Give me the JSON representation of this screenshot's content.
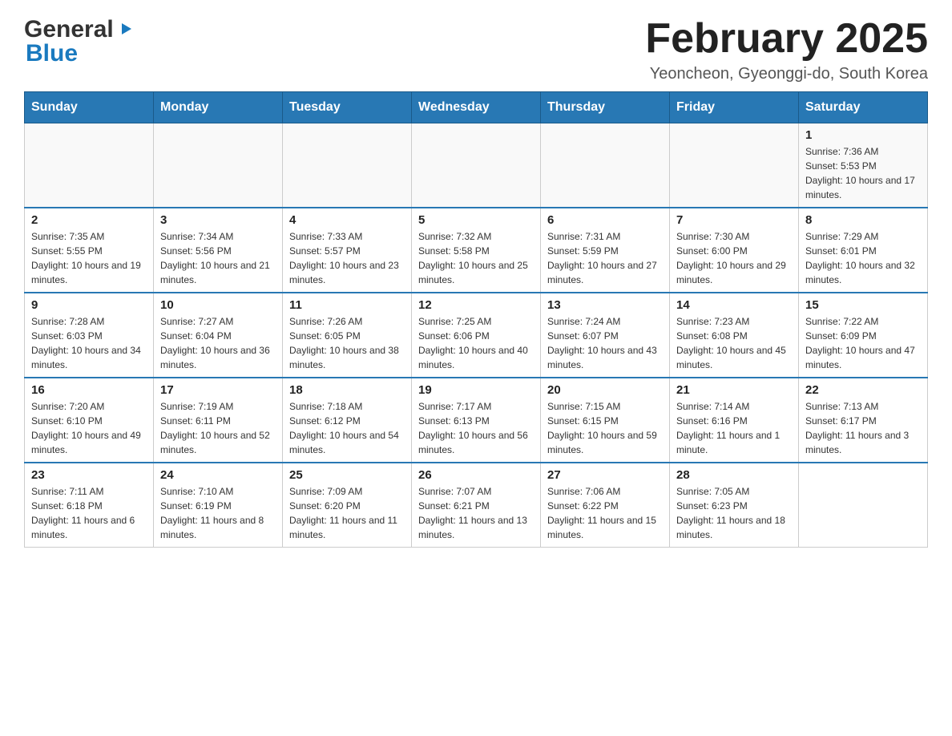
{
  "header": {
    "logo": {
      "general": "General",
      "blue": "Blue"
    },
    "title": "February 2025",
    "location": "Yeoncheon, Gyeonggi-do, South Korea"
  },
  "days_of_week": [
    "Sunday",
    "Monday",
    "Tuesday",
    "Wednesday",
    "Thursday",
    "Friday",
    "Saturday"
  ],
  "weeks": [
    {
      "days": [
        {
          "date": "",
          "sunrise": "",
          "sunset": "",
          "daylight": ""
        },
        {
          "date": "",
          "sunrise": "",
          "sunset": "",
          "daylight": ""
        },
        {
          "date": "",
          "sunrise": "",
          "sunset": "",
          "daylight": ""
        },
        {
          "date": "",
          "sunrise": "",
          "sunset": "",
          "daylight": ""
        },
        {
          "date": "",
          "sunrise": "",
          "sunset": "",
          "daylight": ""
        },
        {
          "date": "",
          "sunrise": "",
          "sunset": "",
          "daylight": ""
        },
        {
          "date": "1",
          "sunrise": "Sunrise: 7:36 AM",
          "sunset": "Sunset: 5:53 PM",
          "daylight": "Daylight: 10 hours and 17 minutes."
        }
      ]
    },
    {
      "days": [
        {
          "date": "2",
          "sunrise": "Sunrise: 7:35 AM",
          "sunset": "Sunset: 5:55 PM",
          "daylight": "Daylight: 10 hours and 19 minutes."
        },
        {
          "date": "3",
          "sunrise": "Sunrise: 7:34 AM",
          "sunset": "Sunset: 5:56 PM",
          "daylight": "Daylight: 10 hours and 21 minutes."
        },
        {
          "date": "4",
          "sunrise": "Sunrise: 7:33 AM",
          "sunset": "Sunset: 5:57 PM",
          "daylight": "Daylight: 10 hours and 23 minutes."
        },
        {
          "date": "5",
          "sunrise": "Sunrise: 7:32 AM",
          "sunset": "Sunset: 5:58 PM",
          "daylight": "Daylight: 10 hours and 25 minutes."
        },
        {
          "date": "6",
          "sunrise": "Sunrise: 7:31 AM",
          "sunset": "Sunset: 5:59 PM",
          "daylight": "Daylight: 10 hours and 27 minutes."
        },
        {
          "date": "7",
          "sunrise": "Sunrise: 7:30 AM",
          "sunset": "Sunset: 6:00 PM",
          "daylight": "Daylight: 10 hours and 29 minutes."
        },
        {
          "date": "8",
          "sunrise": "Sunrise: 7:29 AM",
          "sunset": "Sunset: 6:01 PM",
          "daylight": "Daylight: 10 hours and 32 minutes."
        }
      ]
    },
    {
      "days": [
        {
          "date": "9",
          "sunrise": "Sunrise: 7:28 AM",
          "sunset": "Sunset: 6:03 PM",
          "daylight": "Daylight: 10 hours and 34 minutes."
        },
        {
          "date": "10",
          "sunrise": "Sunrise: 7:27 AM",
          "sunset": "Sunset: 6:04 PM",
          "daylight": "Daylight: 10 hours and 36 minutes."
        },
        {
          "date": "11",
          "sunrise": "Sunrise: 7:26 AM",
          "sunset": "Sunset: 6:05 PM",
          "daylight": "Daylight: 10 hours and 38 minutes."
        },
        {
          "date": "12",
          "sunrise": "Sunrise: 7:25 AM",
          "sunset": "Sunset: 6:06 PM",
          "daylight": "Daylight: 10 hours and 40 minutes."
        },
        {
          "date": "13",
          "sunrise": "Sunrise: 7:24 AM",
          "sunset": "Sunset: 6:07 PM",
          "daylight": "Daylight: 10 hours and 43 minutes."
        },
        {
          "date": "14",
          "sunrise": "Sunrise: 7:23 AM",
          "sunset": "Sunset: 6:08 PM",
          "daylight": "Daylight: 10 hours and 45 minutes."
        },
        {
          "date": "15",
          "sunrise": "Sunrise: 7:22 AM",
          "sunset": "Sunset: 6:09 PM",
          "daylight": "Daylight: 10 hours and 47 minutes."
        }
      ]
    },
    {
      "days": [
        {
          "date": "16",
          "sunrise": "Sunrise: 7:20 AM",
          "sunset": "Sunset: 6:10 PM",
          "daylight": "Daylight: 10 hours and 49 minutes."
        },
        {
          "date": "17",
          "sunrise": "Sunrise: 7:19 AM",
          "sunset": "Sunset: 6:11 PM",
          "daylight": "Daylight: 10 hours and 52 minutes."
        },
        {
          "date": "18",
          "sunrise": "Sunrise: 7:18 AM",
          "sunset": "Sunset: 6:12 PM",
          "daylight": "Daylight: 10 hours and 54 minutes."
        },
        {
          "date": "19",
          "sunrise": "Sunrise: 7:17 AM",
          "sunset": "Sunset: 6:13 PM",
          "daylight": "Daylight: 10 hours and 56 minutes."
        },
        {
          "date": "20",
          "sunrise": "Sunrise: 7:15 AM",
          "sunset": "Sunset: 6:15 PM",
          "daylight": "Daylight: 10 hours and 59 minutes."
        },
        {
          "date": "21",
          "sunrise": "Sunrise: 7:14 AM",
          "sunset": "Sunset: 6:16 PM",
          "daylight": "Daylight: 11 hours and 1 minute."
        },
        {
          "date": "22",
          "sunrise": "Sunrise: 7:13 AM",
          "sunset": "Sunset: 6:17 PM",
          "daylight": "Daylight: 11 hours and 3 minutes."
        }
      ]
    },
    {
      "days": [
        {
          "date": "23",
          "sunrise": "Sunrise: 7:11 AM",
          "sunset": "Sunset: 6:18 PM",
          "daylight": "Daylight: 11 hours and 6 minutes."
        },
        {
          "date": "24",
          "sunrise": "Sunrise: 7:10 AM",
          "sunset": "Sunset: 6:19 PM",
          "daylight": "Daylight: 11 hours and 8 minutes."
        },
        {
          "date": "25",
          "sunrise": "Sunrise: 7:09 AM",
          "sunset": "Sunset: 6:20 PM",
          "daylight": "Daylight: 11 hours and 11 minutes."
        },
        {
          "date": "26",
          "sunrise": "Sunrise: 7:07 AM",
          "sunset": "Sunset: 6:21 PM",
          "daylight": "Daylight: 11 hours and 13 minutes."
        },
        {
          "date": "27",
          "sunrise": "Sunrise: 7:06 AM",
          "sunset": "Sunset: 6:22 PM",
          "daylight": "Daylight: 11 hours and 15 minutes."
        },
        {
          "date": "28",
          "sunrise": "Sunrise: 7:05 AM",
          "sunset": "Sunset: 6:23 PM",
          "daylight": "Daylight: 11 hours and 18 minutes."
        },
        {
          "date": "",
          "sunrise": "",
          "sunset": "",
          "daylight": ""
        }
      ]
    }
  ]
}
